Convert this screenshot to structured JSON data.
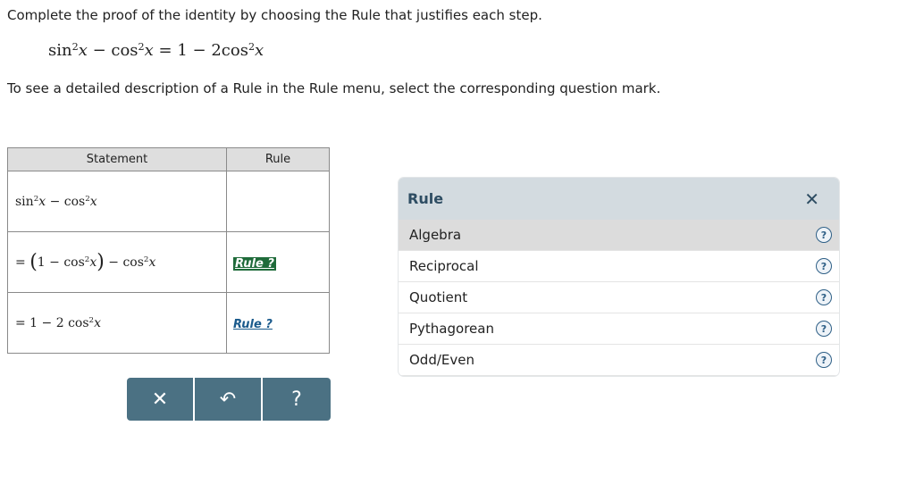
{
  "instructions": {
    "line1": "Complete the proof of the identity by choosing the Rule that justifies each step.",
    "line2": "To see a detailed description of a Rule in the Rule menu, select the corresponding question mark."
  },
  "identity": {
    "left_a": "sin",
    "exp_a": "2",
    "var_a": "x",
    "minus": " − ",
    "left_b": "cos",
    "exp_b": "2",
    "var_b": "x",
    "equals": " = ",
    "right_a": "1 − 2cos",
    "exp_c": "2",
    "var_c": "x"
  },
  "table": {
    "headers": {
      "statement": "Statement",
      "rule": "Rule"
    },
    "rows": [
      {
        "parts": [
          "sin",
          "2",
          "x",
          " − cos",
          "2",
          "x"
        ],
        "rule_label": ""
      },
      {
        "prefix": "= ",
        "open_paren": "(",
        "parts": [
          "1 − cos",
          "2",
          "x"
        ],
        "close_paren": ")",
        "tail": [
          " − cos",
          "2",
          "x"
        ],
        "rule_label": "Rule ?"
      },
      {
        "parts": [
          "= 1 − 2 cos",
          "2",
          "x"
        ],
        "rule_label": "Rule ?"
      }
    ]
  },
  "toolbar": {
    "clear": "✕",
    "undo": "↶",
    "help": "?"
  },
  "rule_panel": {
    "title": "Rule",
    "close": "✕",
    "items": [
      {
        "label": "Algebra",
        "help": "?"
      },
      {
        "label": "Reciprocal",
        "help": "?"
      },
      {
        "label": "Quotient",
        "help": "?"
      },
      {
        "label": "Pythagorean",
        "help": "?"
      },
      {
        "label": "Odd/Even",
        "help": "?"
      }
    ]
  }
}
